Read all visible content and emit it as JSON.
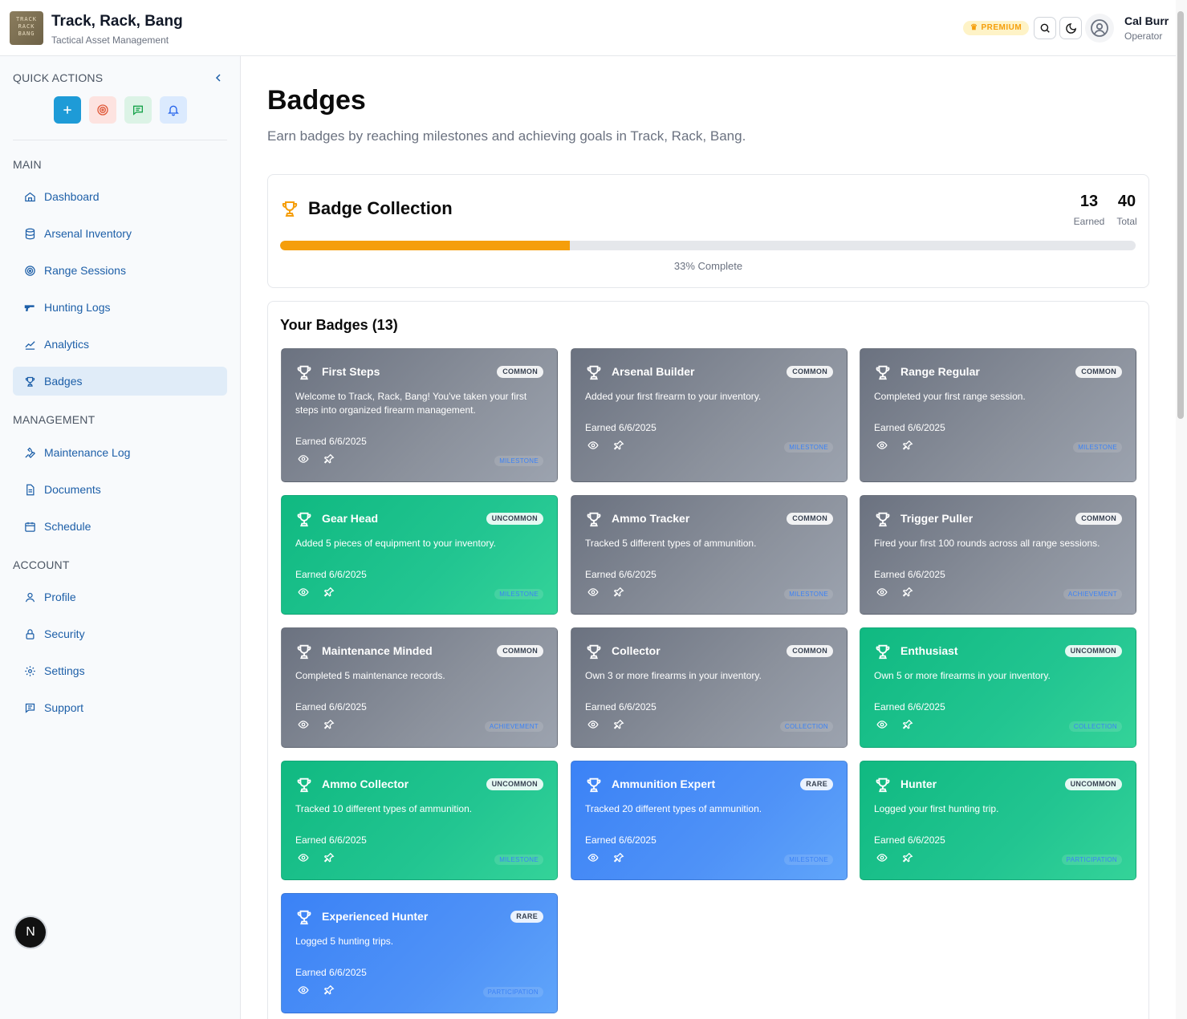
{
  "header": {
    "logo_text": [
      "TRACK",
      "RACK",
      "BANG"
    ],
    "title": "Track, Rack, Bang",
    "subtitle": "Tactical Asset Management",
    "premium_label": "PREMIUM",
    "user_name": "Cal Burr",
    "user_role": "Operator"
  },
  "sidebar": {
    "quick_actions_label": "QUICK ACTIONS",
    "main_label": "MAIN",
    "management_label": "MANAGEMENT",
    "account_label": "ACCOUNT",
    "main_items": [
      {
        "label": "Dashboard",
        "icon": "home-icon"
      },
      {
        "label": "Arsenal Inventory",
        "icon": "database-icon"
      },
      {
        "label": "Range Sessions",
        "icon": "target-icon"
      },
      {
        "label": "Hunting Logs",
        "icon": "gun-icon"
      },
      {
        "label": "Analytics",
        "icon": "chart-line-icon"
      },
      {
        "label": "Badges",
        "icon": "trophy-icon"
      }
    ],
    "management_items": [
      {
        "label": "Maintenance Log",
        "icon": "wrench-icon"
      },
      {
        "label": "Documents",
        "icon": "document-icon"
      },
      {
        "label": "Schedule",
        "icon": "calendar-icon"
      }
    ],
    "account_items": [
      {
        "label": "Profile",
        "icon": "user-icon"
      },
      {
        "label": "Security",
        "icon": "lock-icon"
      },
      {
        "label": "Settings",
        "icon": "gear-icon"
      },
      {
        "label": "Support",
        "icon": "message-icon"
      }
    ],
    "active_item": "Badges",
    "next_badge": "N"
  },
  "main": {
    "title": "Badges",
    "subtitle": "Earn badges by reaching milestones and achieving goals in Track, Rack, Bang.",
    "collection": {
      "title": "Badge Collection",
      "earned": "13",
      "earned_label": "Earned",
      "total": "40",
      "total_label": "Total",
      "progress": 0.33,
      "progress_text": "33% Complete"
    },
    "your_badges_title": "Your Badges (13)",
    "badges": [
      {
        "name": "First Steps",
        "rarity": "COMMON",
        "desc": "Welcome to Track, Rack, Bang! You've taken your first steps into organized firearm management.",
        "earned": "Earned 6/6/2025",
        "category": "MILESTONE",
        "color": "gray"
      },
      {
        "name": "Arsenal Builder",
        "rarity": "COMMON",
        "desc": "Added your first firearm to your inventory.",
        "earned": "Earned 6/6/2025",
        "category": "MILESTONE",
        "color": "gray"
      },
      {
        "name": "Range Regular",
        "rarity": "COMMON",
        "desc": "Completed your first range session.",
        "earned": "Earned 6/6/2025",
        "category": "MILESTONE",
        "color": "gray"
      },
      {
        "name": "Gear Head",
        "rarity": "UNCOMMON",
        "desc": "Added 5 pieces of equipment to your inventory.",
        "earned": "Earned 6/6/2025",
        "category": "MILESTONE",
        "color": "green"
      },
      {
        "name": "Ammo Tracker",
        "rarity": "COMMON",
        "desc": "Tracked 5 different types of ammunition.",
        "earned": "Earned 6/6/2025",
        "category": "MILESTONE",
        "color": "gray"
      },
      {
        "name": "Trigger Puller",
        "rarity": "COMMON",
        "desc": "Fired your first 100 rounds across all range sessions.",
        "earned": "Earned 6/6/2025",
        "category": "ACHIEVEMENT",
        "color": "gray"
      },
      {
        "name": "Maintenance Minded",
        "rarity": "COMMON",
        "desc": "Completed 5 maintenance records.",
        "earned": "Earned 6/6/2025",
        "category": "ACHIEVEMENT",
        "color": "gray"
      },
      {
        "name": "Collector",
        "rarity": "COMMON",
        "desc": "Own 3 or more firearms in your inventory.",
        "earned": "Earned 6/6/2025",
        "category": "COLLECTION",
        "color": "gray"
      },
      {
        "name": "Enthusiast",
        "rarity": "UNCOMMON",
        "desc": "Own 5 or more firearms in your inventory.",
        "earned": "Earned 6/6/2025",
        "category": "COLLECTION",
        "color": "green"
      },
      {
        "name": "Ammo Collector",
        "rarity": "UNCOMMON",
        "desc": "Tracked 10 different types of ammunition.",
        "earned": "Earned 6/6/2025",
        "category": "MILESTONE",
        "color": "green"
      },
      {
        "name": "Ammunition Expert",
        "rarity": "RARE",
        "desc": "Tracked 20 different types of ammunition.",
        "earned": "Earned 6/6/2025",
        "category": "MILESTONE",
        "color": "blue"
      },
      {
        "name": "Hunter",
        "rarity": "UNCOMMON",
        "desc": "Logged your first hunting trip.",
        "earned": "Earned 6/6/2025",
        "category": "PARTICIPATION",
        "color": "green"
      },
      {
        "name": "Experienced Hunter",
        "rarity": "RARE",
        "desc": "Logged 5 hunting trips.",
        "earned": "Earned 6/6/2025",
        "category": "PARTICIPATION",
        "color": "blue"
      }
    ]
  },
  "colors": {
    "accent": "#1d5fa8",
    "progress": "#f59e0b",
    "premium": "#f59e0b"
  }
}
